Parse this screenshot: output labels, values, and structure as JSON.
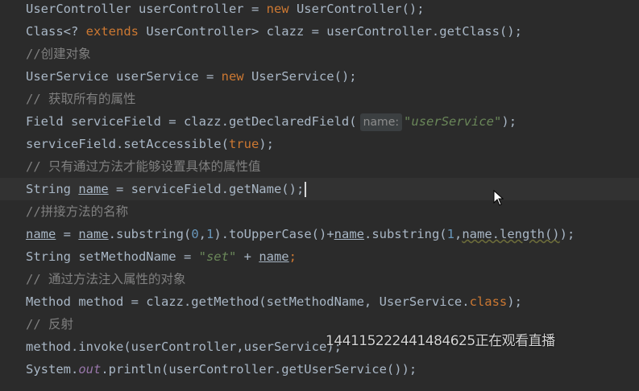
{
  "code": {
    "l1": [
      "UserController userController = ",
      "new",
      " UserController();"
    ],
    "l2": [
      "Class<? ",
      "extends",
      " UserController> clazz = userController.getClass();"
    ],
    "l3": [
      "//创建对象"
    ],
    "l4": [
      "UserService userService = ",
      "new",
      " UserService();"
    ],
    "l5": [
      "// 获取所有的属性"
    ],
    "l6": [
      "Field serviceField = clazz.getDeclaredField(",
      "name:",
      "\"userService\"",
      ");"
    ],
    "l7": [
      "serviceField.setAccessible(",
      "true",
      ");"
    ],
    "l8": [
      "// 只有通过方法才能够设置具体的属性值"
    ],
    "l9": [
      "String ",
      "name",
      " = serviceField.getName();"
    ],
    "l10": [
      "//拼接方法的名称"
    ],
    "l11": [
      "name",
      " = ",
      "name",
      ".substring(",
      "0",
      ",",
      "1",
      ").toUpperCase()+",
      "name",
      ".substring(",
      "1",
      ",",
      "name.length()",
      ");"
    ],
    "l12": [
      "String setMethodName = ",
      "\"set\"",
      " + ",
      "name",
      ";"
    ],
    "l13": [
      "// 通过方法注入属性的对象"
    ],
    "l14": [
      "Method method = clazz.getMethod(setMethodName, UserService.",
      "class",
      ");"
    ],
    "l15": [
      "// 反射"
    ],
    "l16": [
      "method.invoke(userController,userService);"
    ],
    "l17": [
      "System.",
      "out",
      ".println(userController.getUserService());"
    ]
  },
  "overlay_text": "144115222441484625正在观看直播",
  "colors": {
    "background": "#2b2b2b",
    "default_text": "#a9b7c6",
    "keyword": "#cc7832",
    "string": "#6a8759",
    "comment": "#808080",
    "number": "#6897bb",
    "static_field": "#9876aa"
  },
  "icons": {
    "cursor": "mouse-pointer-icon"
  }
}
